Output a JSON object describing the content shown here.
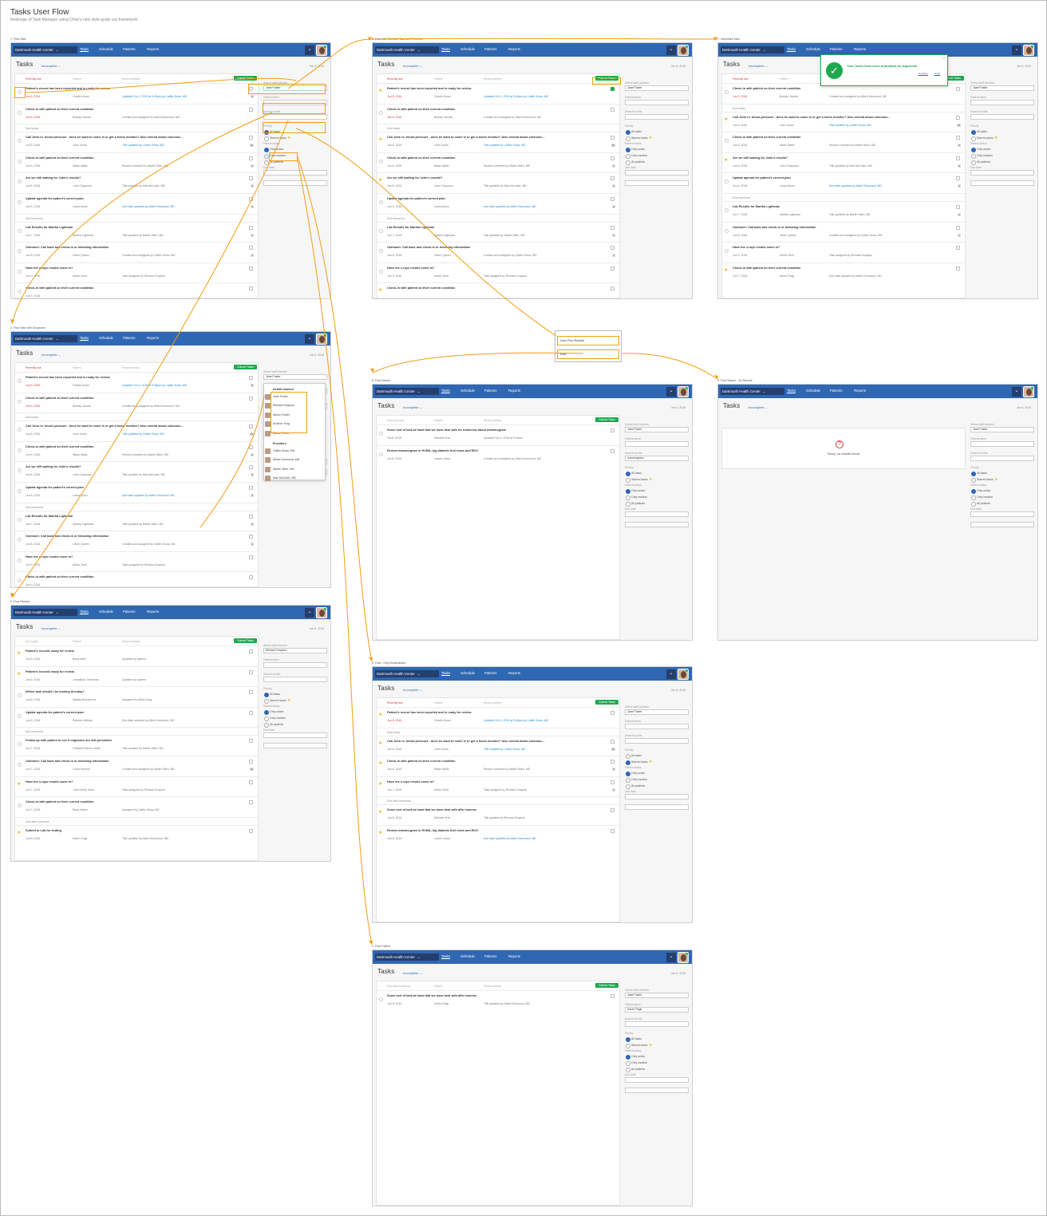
{
  "doc": {
    "title": "Tasks User Flow",
    "subtitle": "Redesign of Task Manager using Chirp's new style guide css framework."
  },
  "nav": {
    "brand": "Dartmouth Health Center",
    "tabs": [
      "Tasks",
      "Schedule",
      "Patients",
      "Reports"
    ]
  },
  "common": {
    "title": "Tasks",
    "filter": "Incomplete",
    "date": "Jun 6, 2016",
    "submit": "Submit Tasks",
    "col_patient": "Patient",
    "col_activity": "Recent activity"
  },
  "sidebar": {
    "staff_label": "Select staff member",
    "patient_label": "Patient name",
    "search_label": "Search by title",
    "priority_label": "Priority",
    "all_tasks": "All tasks",
    "starred": "Starred tasks",
    "status_label": "Patient status",
    "only_active": "Only active",
    "only_inactive": "Only inactive",
    "all_patients": "All patients",
    "due_label": "Due date"
  },
  "colors": {
    "nav": "#2f67b2",
    "brand": "#243e6e",
    "submit": "#1ea94f",
    "flow": "#f29c12",
    "alert": "#d33"
  },
  "flows": {
    "f1": "1. Flow Start",
    "f2": "2. Flow Start with Dropdown",
    "f3": "3. Flow with Checked Task and Favorites",
    "f4": "4. Flow Patient",
    "f5": "5. Flow - Only Bookmarked",
    "f6": "6. Flow Richard",
    "f7": "7. Submitted Task",
    "f8": "8. Flow Search",
    "f9": "9. Flow Search - No Results"
  },
  "toast": {
    "message": "Your Tasks have been Submitted for Approval!",
    "link1": "Continue",
    "link2": "Undo"
  },
  "noresults": "Sorry, no results found",
  "decision": {
    "opt1": "User Find Results",
    "opt2": "Else..."
  },
  "dropdown": {
    "group1": "Health coaches",
    "coaches": [
      "Jane Foster",
      "Richard Grayson",
      "Alison Foster",
      "Another King",
      "Diane Pierce"
    ],
    "group2": "Providers",
    "providers": [
      "Caitlin Snow, MD",
      "Albert Desmond, MD",
      "Martin Stien, MD",
      "Mari McCabe, MD"
    ]
  },
  "lists": {
    "main": [
      {
        "s": "Recently due"
      },
      {
        "t": "Patient's record has been exported and is ready for review.",
        "d": "Jun 5, 2016",
        "p": "Charlie Anasi",
        "a": "Updated Oct 4, 2016 at 9:45pm by Caitlin Snow, MD",
        "r": 1,
        "it": 1,
        "c": "5"
      },
      {
        "t": "Check-in with patient on their current condition",
        "d": "Jun 5, 2016",
        "p": "Brandy Jacobs",
        "a": "Created and assigned by Albert Desmond, MD",
        "r": 1
      },
      {
        "s": "Due today"
      },
      {
        "t": "Call John re: blood pressure - does he want to come in or get a home monitor? Also remind about colonosc...",
        "d": "Jun 6, 2016",
        "p": "John Jones",
        "a": "Title updated by Caitlin Snow, MD",
        "it": 1,
        "c": "10"
      },
      {
        "t": "Check-in with patient on their current condition",
        "d": "Jun 6, 2016",
        "p": "Wade Waltz",
        "a": "Recent comment by Martin Stien, MD",
        "c": "2"
      },
      {
        "t": "Are we still waiting for John's results?",
        "d": "Jun 6, 2016",
        "p": "John Chapman",
        "a": "Title updated by Mari McCabe, MD",
        "c": "3"
      },
      {
        "t": "Update agenda for patient's current plan",
        "d": "Jun 6, 2016",
        "p": "Laura Moon",
        "a": "Due date updated by Albert Desmond, MD",
        "it": 1,
        "c": "4"
      },
      {
        "s": "Due tomorrow"
      },
      {
        "t": "Lab Results for Martha Lightman",
        "d": "Jun 7, 2016",
        "p": "Martha Lightman",
        "a": "Title updated by Martin Stien, MD",
        "c": "4"
      },
      {
        "t": "Outreach: Call back and check-in or following information",
        "d": "Jun 8, 2016",
        "p": "Oliver Queen",
        "a": "Created and assigned by Caitlin Snow, MD",
        "c": "1"
      },
      {
        "t": "Have the x-rays results come in?",
        "d": "Jun 9, 2016",
        "p": "Arthur Dent",
        "a": "Task assigned by Richard Grayson"
      },
      {
        "t": "Check-in with patient on their current condition",
        "d": "Jun 9, 2016",
        "p": "",
        "a": ""
      }
    ],
    "f3": [
      {
        "s": "Recently due"
      },
      {
        "t": "Patient's record has been exported and is ready for review.",
        "d": "Jun 5, 2016",
        "p": "Charlie Anasi",
        "a": "Updated Oct 4, 2016 at 9:45pm by Caitlin Snow, MD",
        "r": 1,
        "it": 1,
        "star": 1,
        "on": 1
      },
      {
        "t": "Check-in with patient on their current condition",
        "d": "Jun 5, 2016",
        "p": "Brandy Jacobs",
        "a": "Created and assigned by Albert Desmond, MD",
        "r": 1
      },
      {
        "s": "Due today"
      },
      {
        "t": "Call John re: blood pressure - does he want to come in or get a home monitor? Also remind about colonosc...",
        "d": "Jun 6, 2016",
        "p": "John Jones",
        "a": "Title updated by Caitlin Snow, MD",
        "it": 1,
        "star": 1,
        "c": "10"
      },
      {
        "t": "Check-in with patient on their current condition",
        "d": "Jun 6, 2016",
        "p": "Wade Waltz",
        "a": "Recent comment by Martin Stien, MD",
        "c": "2"
      },
      {
        "t": "Are we still waiting for John's results?",
        "d": "Jun 6, 2016",
        "p": "John Chapman",
        "a": "Title updated by Mari McCabe, MD",
        "star": 1,
        "c": "3"
      },
      {
        "t": "Update agenda for patient's current plan",
        "d": "Jun 6, 2016",
        "p": "Laura Moon",
        "a": "Due date updated by Albert Desmond, MD",
        "it": 1,
        "c": "4"
      },
      {
        "s": "Due tomorrow"
      },
      {
        "t": "Lab Results for Martha Lightman",
        "d": "Jun 7, 2016",
        "p": "Martha Lightman",
        "a": "Title updated by Martin Stien, MD",
        "c": "4"
      },
      {
        "t": "Outreach: Call back and check-in or following information",
        "d": "Jun 8, 2016",
        "p": "Oliver Queen",
        "a": "Created and assigned by Caitlin Snow, MD",
        "c": "1"
      },
      {
        "t": "Have the x-rays results come in?",
        "d": "Jun 9, 2016",
        "p": "Arthur Dent",
        "a": "Task assigned by Richard Grayson"
      },
      {
        "t": "Check-in with patient on their current condition",
        "d": "",
        "p": "",
        "a": "",
        "star": 1
      }
    ],
    "f7": [
      {
        "s": "Recently due"
      },
      {
        "t": "Check-in with patient on their current condition",
        "d": "Jun 5, 2016",
        "p": "Brandy Jacobs",
        "a": "Created and assigned by Albert Desmond, MD",
        "r": 1
      },
      {
        "s": "Due today"
      },
      {
        "t": "Call John re: blood pressure - does he want to come in or get a home monitor? Also remind about colonosc...",
        "d": "Jun 6, 2016",
        "p": "John Jones",
        "a": "Title updated by Caitlin Snow, MD",
        "it": 1,
        "star": 1,
        "c": "10"
      },
      {
        "t": "Check-in with patient on their current condition",
        "d": "Jun 6, 2016",
        "p": "Wade Waltz",
        "a": "Recent comment by Martin Stien, MD",
        "c": "2"
      },
      {
        "t": "Are we still waiting for John's results?",
        "d": "Jun 6, 2016",
        "p": "John Chapman",
        "a": "Title updated by Mari McCabe, MD",
        "star": 1,
        "c": "3"
      },
      {
        "t": "Update agenda for patient's current plan",
        "d": "Jun 6, 2016",
        "p": "Laura Moon",
        "a": "Due date updated by Albert Desmond, MD",
        "it": 1,
        "c": "4"
      },
      {
        "s": "Due tomorrow"
      },
      {
        "t": "Lab Results for Martha Lightman",
        "d": "Jun 7, 2016",
        "p": "Martha Lightman",
        "a": "Title updated by Martin Stien, MD",
        "c": "4"
      },
      {
        "t": "Outreach: Call back and check-in or following information",
        "d": "Jun 8, 2016",
        "p": "Oliver Queen",
        "a": "Created and assigned by Caitlin Snow, MD",
        "c": "1"
      },
      {
        "t": "Have the x-rays results come in?",
        "d": "Jun 9, 2016",
        "p": "Arthur Dent",
        "a": "Task assigned by Richard Grayson"
      },
      {
        "t": "Check-in with patient on their current condition",
        "d": "Jun 7, 2016",
        "p": "Karen Page",
        "a": "Due date updated by Albert Desmond, MD",
        "star": 1
      }
    ],
    "f6": [
      {
        "s": "Due today"
      },
      {
        "t": "Patient's records ready for review.",
        "d": "Jun 6, 2016",
        "p": "Barry Allen",
        "a": "Updated by system",
        "star": 1
      },
      {
        "t": "Patient's records ready for review.",
        "d": "Jun 6, 2016",
        "p": "Johnathon Osterman",
        "a": "Updated by system",
        "star": 1
      },
      {
        "t": "Which task should I be looking at today?",
        "d": "Jun 6, 2016",
        "p": "Natalia Romanova",
        "a": "Assigned by Arthur King"
      },
      {
        "t": "Update agenda for patient's current plan",
        "d": "Jun 6, 2016",
        "p": "Remick LeBeau",
        "a": "Due date updated by Albert Desmond, MD"
      },
      {
        "s": "Due tomorrow"
      },
      {
        "t": "Follow up with patient to see if migraines are still persistent",
        "d": "Jun 7, 2016",
        "p": "Charles Francis Xavier",
        "a": "Title updated by Martin Stien, MD"
      },
      {
        "t": "Outreach: Call back and check-in or following information",
        "d": "Jun 7, 2016",
        "p": "Orora Monroe",
        "a": "Created and assigned by Martin Stien, MD",
        "c": "10"
      },
      {
        "t": "Have the x-rays results come in?",
        "d": "Jun 7, 2016",
        "p": "John Henry Irons",
        "a": "Task assigned by Richard Grayson",
        "star": 1
      },
      {
        "t": "Check-in with patient on their current condition",
        "d": "Jun 7, 2016",
        "p": "Mina Harker",
        "a": "Assigned by Caitlin Snow, MD"
      },
      {
        "s": "Due after tomorrow"
      },
      {
        "t": "Submit to Lab for testing",
        "d": "Jun 8, 2016",
        "p": "Karen Page",
        "a": "Title updated by Albert Desmond, MD",
        "star": 1
      }
    ],
    "f8": [
      {
        "t": "Some sort of task at hand that we must deal with for tomorrow about mammogram",
        "d": "Oct 8, 2016",
        "p": "Michelle Holt",
        "a": "Updated Oct 1, 2016 at 9:45am"
      },
      {
        "t": "Review mammogram in HVMA, log diabetic foot exam and EKG",
        "d": "Oct 8, 2016",
        "p": "Laurel Lance",
        "a": "Created and assigned by Albert Desmond, MD"
      }
    ],
    "f5": [
      {
        "s": "Recently due"
      },
      {
        "t": "Patient's record has been exported and is ready for review.",
        "d": "Jun 5, 2016",
        "p": "Charlie Anasi",
        "a": "Updated Oct 4, 2016 at 9:45pm by Caitlin Snow, MD",
        "r": 1,
        "it": 1,
        "star": 1
      },
      {
        "s": "Due today"
      },
      {
        "t": "Call John re: blood pressure - does he want to come in or get a home monitor? Also remind about colonosc...",
        "d": "Jun 6, 2016",
        "p": "John Jones",
        "a": "Title updated by Caitlin Snow, MD",
        "it": 1,
        "star": 1,
        "c": "10"
      },
      {
        "t": "Check-in with patient on their current condition",
        "d": "Jun 6, 2016",
        "p": "Wade Waltz",
        "a": "Recent comment by Martin Stien, MD",
        "star": 1,
        "c": "2"
      },
      {
        "t": "Have the x-rays results come in?",
        "d": "Jun 7, 2016",
        "p": "Arthur Dent",
        "a": "Task assigned by Richard Grayson",
        "star": 1,
        "c": "4"
      },
      {
        "s": "Due after tomorrow"
      },
      {
        "t": "Some sort of task at hand that we must deal with after tomrow",
        "d": "Jun 8, 2016",
        "p": "Michelle Holt",
        "a": "Title updated by Richard Grayson",
        "star": 1
      },
      {
        "t": "Review mammogram in HVMA, log diabetic foot exam and EKG",
        "d": "Jun 8, 2016",
        "p": "Laurel Lance",
        "a": "Due date updated by Albert Desmond, MD",
        "it": 1,
        "star": 1
      }
    ],
    "f4": [
      {
        "t": "Some sort of task at hand that we must deal with after tomrow",
        "d": "Jun 8, 2016",
        "p": "Karen Page",
        "a": "Title updated by Albert Desmond, MD"
      }
    ]
  },
  "frames": [
    {
      "id": "f1",
      "lab": "flows.f1",
      "list": "main",
      "head": "Recently due",
      "staff": "Jane Foster"
    },
    {
      "id": "f2",
      "lab": "flows.f2",
      "list": "main",
      "head": "Recently due",
      "staff": "Jane Foster",
      "dd": 1
    },
    {
      "id": "f3",
      "lab": "flows.f3",
      "list": "f3",
      "head": "Recently due",
      "staff": "Jane Foster",
      "starred": 1
    },
    {
      "id": "f7",
      "lab": "flows.f7",
      "list": "f7",
      "head": "Recently due",
      "staff": "Jane Foster",
      "toast": 1
    },
    {
      "id": "f6",
      "lab": "flows.f6",
      "list": "f6",
      "head": "Due today",
      "staff": "Richard Grayson"
    },
    {
      "id": "f8",
      "lab": "flows.f8",
      "list": "f8",
      "head": "Due tomorrow",
      "staff": "Jane Foster",
      "search": "mammogram"
    },
    {
      "id": "f9",
      "lab": "flows.f9",
      "list": "none",
      "head": "",
      "staff": "Jane Foster",
      "noresult": 1
    },
    {
      "id": "f5",
      "lab": "flows.f5",
      "list": "f5",
      "head": "Recently due",
      "staff": "Jane Foster",
      "starredOn": 1
    },
    {
      "id": "f4",
      "lab": "flows.f4",
      "list": "f4",
      "head": "Due after tomorrow",
      "staff": "Jane Foster",
      "patient": "Karen Page"
    }
  ]
}
